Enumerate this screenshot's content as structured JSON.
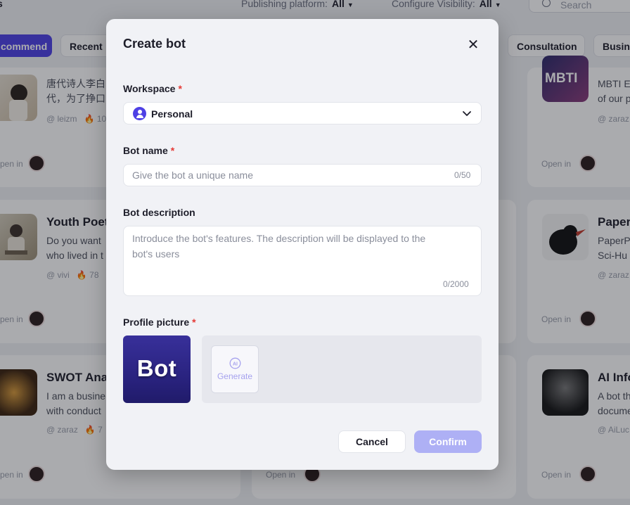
{
  "background": {
    "header_left": "s",
    "filters": [
      {
        "label": "Publishing platform:",
        "value": "All"
      },
      {
        "label": "Configure Visibility:",
        "value": "All"
      }
    ],
    "search_placeholder": "Search",
    "tabs": [
      "commend",
      "Recent",
      "Consultation",
      "Busine"
    ],
    "cards": [
      {
        "title": "",
        "desc": [
          "唐代诗人李白",
          "代，为了挣口"
        ],
        "author": "@ leizm",
        "stat": "10",
        "open_in": "pen in"
      },
      {
        "title": "",
        "desc": [
          "MBTI E",
          "of our p"
        ],
        "author": "@ zaraz",
        "stat": "",
        "open_in": "Open in",
        "thumb_text": "MBTI"
      },
      {
        "title": "Youth Poet",
        "desc": [
          "Do you want",
          "who lived in t"
        ],
        "author": "@ vivi",
        "stat": "78",
        "open_in": "pen in"
      },
      {
        "title": "PaperP",
        "desc": [
          "PaperP",
          "Sci-Hu"
        ],
        "author": "@ zaraz",
        "stat": "",
        "open_in": "Open in"
      },
      {
        "title": "SWOT Anal",
        "desc": [
          "I am a busine",
          "with conduct"
        ],
        "author": "@ zaraz",
        "stat": "7",
        "open_in": "pen in"
      },
      {
        "title": "AI Info",
        "desc": [
          "A bot th",
          "docume"
        ],
        "author": "@ AiLuc",
        "stat": "",
        "open_in": "Open in"
      },
      {
        "title": "",
        "desc": [
          "",
          ""
        ],
        "author": "",
        "stat": "",
        "open_in": "Open in"
      }
    ]
  },
  "modal": {
    "title": "Create bot",
    "workspace": {
      "label": "Workspace",
      "required": "*",
      "value": "Personal"
    },
    "bot_name": {
      "label": "Bot name",
      "required": "*",
      "placeholder": "Give the bot a unique name",
      "counter": "0/50"
    },
    "bot_description": {
      "label": "Bot description",
      "placeholder": "Introduce the bot's features. The description will be displayed to the bot's users",
      "counter": "0/2000"
    },
    "profile_picture": {
      "label": "Profile picture",
      "required": "*",
      "image_text": "Bot",
      "generate_label": "Generate",
      "generate_icon_text": "AI"
    },
    "cancel_label": "Cancel",
    "confirm_label": "Confirm"
  },
  "colors": {
    "accent": "#4e40e5",
    "confirm_disabled": "#aeb0f5",
    "required": "#e53935"
  }
}
